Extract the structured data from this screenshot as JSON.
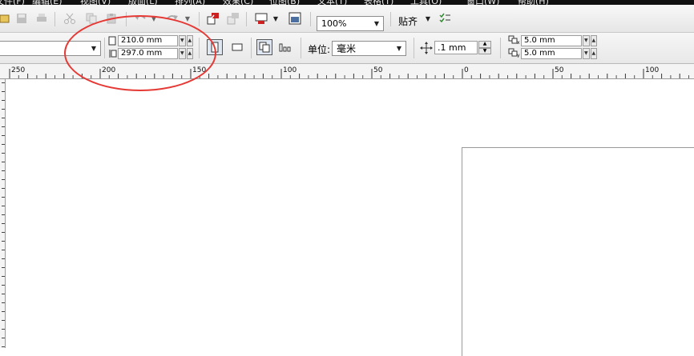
{
  "menubar": {
    "items": [
      "文件(F)",
      "编辑(E)",
      "视图(V)",
      "版面(L)",
      "排列(A)",
      "效果(C)",
      "位图(B)",
      "文本(T)",
      "表格(T)",
      "工具(O)",
      "窗口(W)",
      "帮助(H)"
    ]
  },
  "toolbar": {
    "zoom": "100%",
    "snap_label": "贴齐"
  },
  "property_bar": {
    "page_width": "210.0 mm",
    "page_height": "297.0 mm",
    "units_label": "单位:",
    "units_value": "毫米",
    "nudge": ".1 mm",
    "dup_x": "5.0 mm",
    "dup_y": "5.0 mm"
  },
  "ruler": {
    "ticks": [
      {
        "value": 250,
        "label": "250"
      },
      {
        "value": 200,
        "label": "200"
      },
      {
        "value": 150,
        "label": "150"
      },
      {
        "value": 100,
        "label": "100"
      },
      {
        "value": 50,
        "label": "50"
      },
      {
        "value": 0,
        "label": "0"
      },
      {
        "value": -50,
        "label": "50"
      },
      {
        "value": -100,
        "label": "100"
      }
    ]
  },
  "colors": {
    "annotation": "#e53935",
    "menubar_bg": "#111111"
  }
}
